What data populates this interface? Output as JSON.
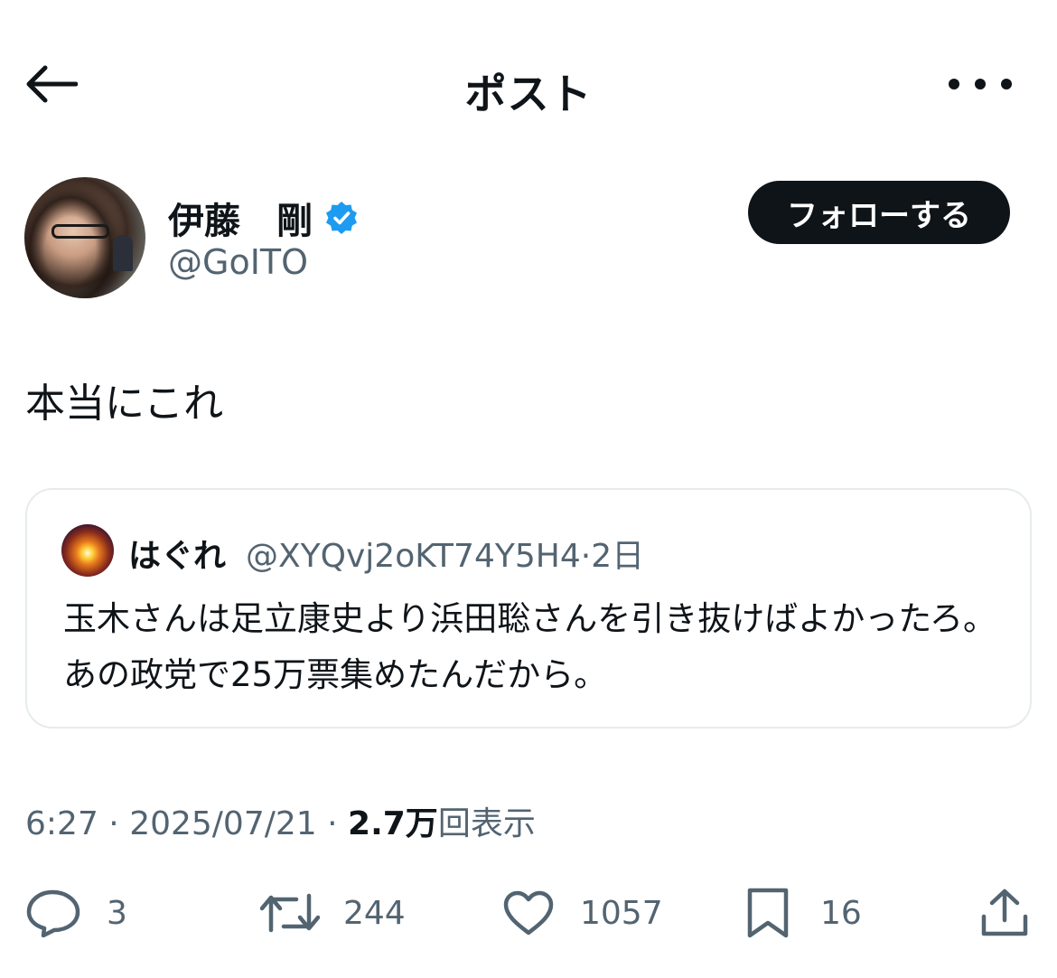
{
  "header": {
    "title": "ポスト"
  },
  "author": {
    "name": "伊藤　剛",
    "handle": "@GoITO",
    "follow_label": "フォローする",
    "verified_color": "#1d9bf0"
  },
  "tweet": {
    "text": "本当にこれ"
  },
  "quote": {
    "name": "はぐれ",
    "handle": "@XYQvj2oKT74Y5H4",
    "separator": "·",
    "time": "2日",
    "text": "玉木さんは足立康史より浜田聡さんを引き抜けばよかったろ。あの政党で25万票集めたんだから。"
  },
  "meta": {
    "time": "6:27",
    "sep1": " · ",
    "date": "2025/07/21",
    "sep2": " · ",
    "views_count": "2.7万",
    "views_label": "回表示"
  },
  "actions": {
    "reply_count": "3",
    "retweet_count": "244",
    "like_count": "1057",
    "bookmark_count": "16"
  },
  "icons": {
    "back": "arrow-left-icon",
    "more": "more-horizontal-icon",
    "verified": "verified-badge-icon",
    "reply": "reply-bubble-icon",
    "retweet": "retweet-icon",
    "like": "heart-icon",
    "bookmark": "bookmark-icon",
    "share": "share-icon"
  }
}
